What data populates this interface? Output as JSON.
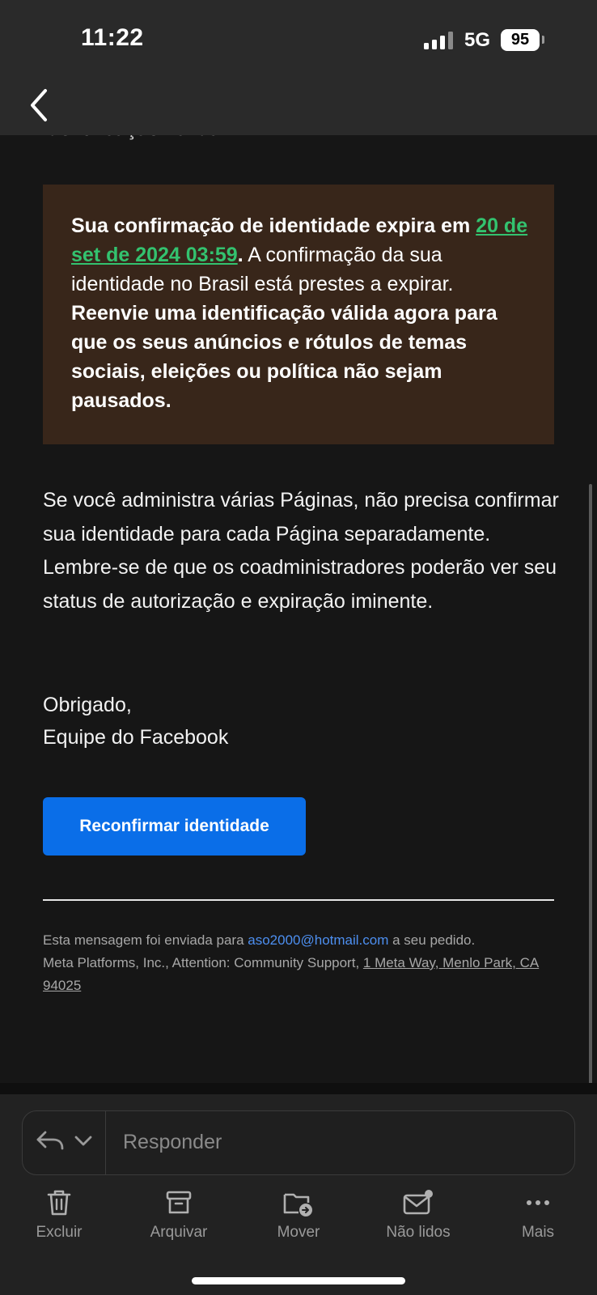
{
  "status_bar": {
    "time": "11:22",
    "network": "5G",
    "battery": "95"
  },
  "email": {
    "clipped_text": "identificação válida.",
    "warning": {
      "lead_bold": "Sua confirmação de identidade expira em",
      "date_link": "20 de set de 2024 03:59",
      "after_link_punct": ".",
      "normal": " A confirmação da sua identidade no Brasil está prestes a expirar. ",
      "tail_bold": "Reenvie uma identificação válida agora para que os seus anúncios e rótulos de temas sociais, eleições ou política não sejam pausados."
    },
    "paragraph": "Se você administra várias Páginas, não precisa confirmar sua identidade para cada Página separadamente. Lembre-se de que os coadministradores poderão ver seu status de autorização e expiração iminente.",
    "signoff_1": "Obrigado,",
    "signoff_2": "Equipe do Facebook",
    "cta_label": "Reconfirmar identidade",
    "footer": {
      "prefix": "Esta mensagem foi enviada para ",
      "email": "aso2000@hotmail.com",
      "suffix": " a seu pedido.",
      "company": "Meta Platforms, Inc., Attention: Community Support, ",
      "address": "1 Meta Way, Menlo Park, CA 94025"
    }
  },
  "reply": {
    "placeholder": "Responder"
  },
  "toolbar": [
    {
      "label": "Excluir",
      "icon": "trash-icon"
    },
    {
      "label": "Arquivar",
      "icon": "archive-icon"
    },
    {
      "label": "Mover",
      "icon": "move-folder-icon"
    },
    {
      "label": "Não lidos",
      "icon": "unread-mail-icon"
    },
    {
      "label": "Mais",
      "icon": "more-icon"
    }
  ],
  "colors": {
    "accent_button": "#0a6ee8",
    "date_link": "#33c26f",
    "warning_bg": "#38261a",
    "footer_link": "#4d8ff0"
  }
}
